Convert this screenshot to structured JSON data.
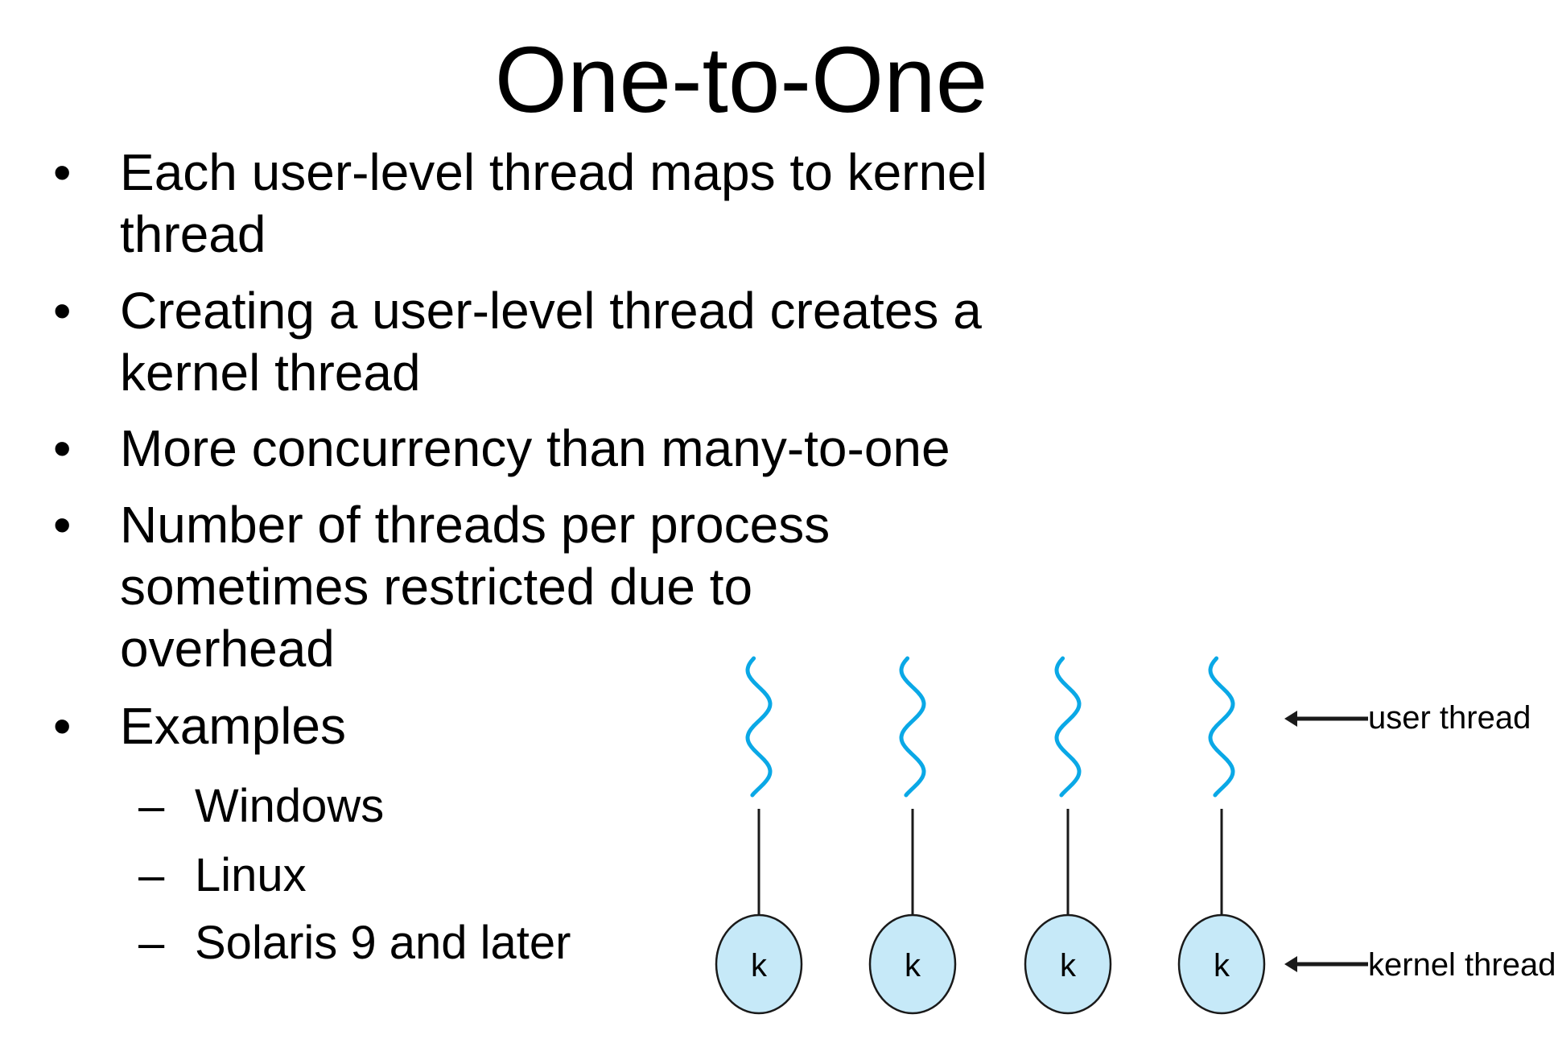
{
  "slide": {
    "title": "One-to-One",
    "bullets": [
      {
        "lines": [
          "Each user-level thread maps to kernel",
          "thread"
        ]
      },
      {
        "lines": [
          "Creating a user-level thread creates a",
          "kernel thread"
        ]
      },
      {
        "lines": [
          "More concurrency than many-to-one"
        ]
      },
      {
        "lines": [
          "Number of threads per process",
          "sometimes restricted due to",
          "overhead"
        ]
      },
      {
        "lines": [
          "Examples"
        ]
      }
    ],
    "sub_items": [
      "Windows",
      "Linux",
      "Solaris 9 and later"
    ],
    "bullet_glyph": "•",
    "dash_glyph": "–"
  },
  "diagram": {
    "kernel_label": "k",
    "user_thread_label": "user thread",
    "kernel_thread_label": "kernel thread",
    "thread_count": 4,
    "colors": {
      "wave": "#0aa8e6",
      "kernel_fill": "#c6e9f8",
      "stroke": "#1a1a1a"
    }
  }
}
